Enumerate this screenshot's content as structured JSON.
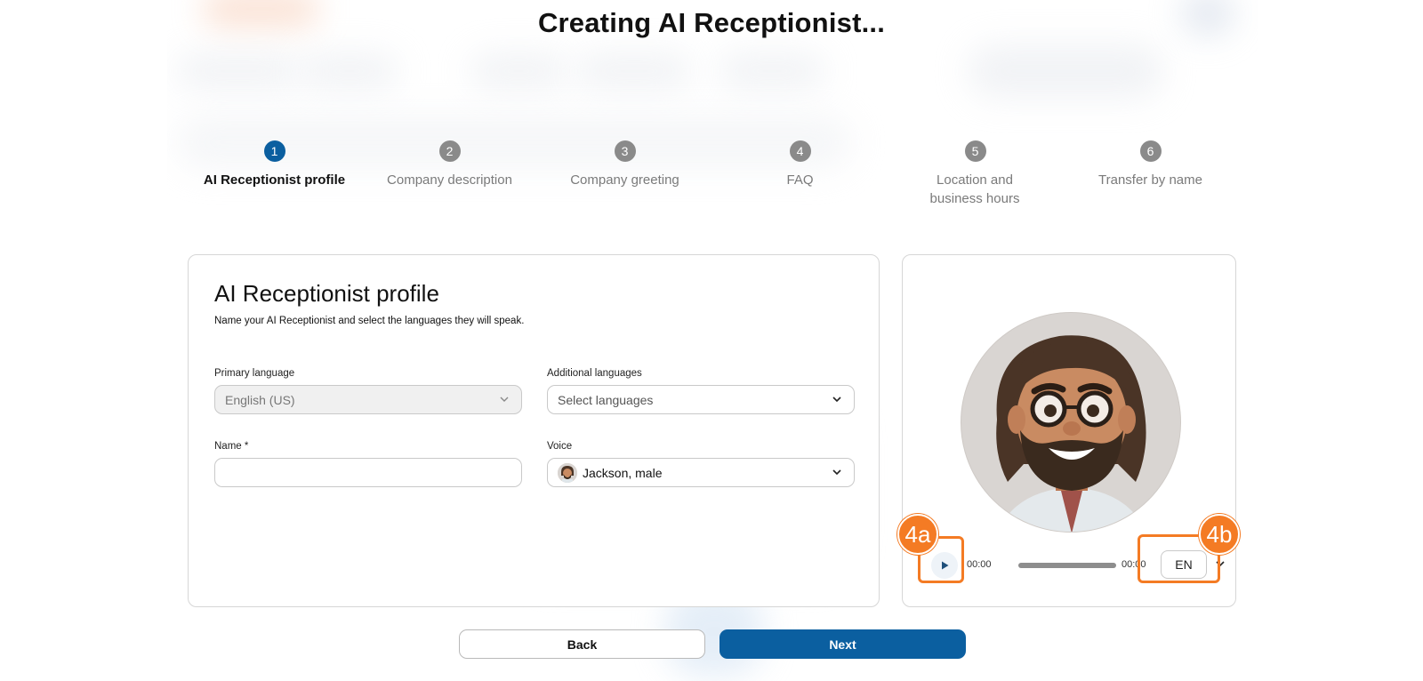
{
  "page": {
    "title": "Creating AI Receptionist..."
  },
  "steps": [
    {
      "number": "1",
      "label": "AI Receptionist profile",
      "active": true
    },
    {
      "number": "2",
      "label": "Company description",
      "active": false
    },
    {
      "number": "3",
      "label": "Company greeting",
      "active": false
    },
    {
      "number": "4",
      "label": "FAQ",
      "active": false
    },
    {
      "number": "5",
      "label": "Location and business hours",
      "active": false
    },
    {
      "number": "6",
      "label": "Transfer by name",
      "active": false
    }
  ],
  "profile": {
    "title": "AI Receptionist profile",
    "subtitle": "Name your AI Receptionist and select the languages they will speak.",
    "primary_language": {
      "label": "Primary language",
      "value": "English (US)"
    },
    "additional_languages": {
      "label": "Additional languages",
      "placeholder": "Select languages"
    },
    "name": {
      "label": "Name *",
      "value": ""
    },
    "voice": {
      "label": "Voice",
      "value": "Jackson, male"
    }
  },
  "player": {
    "current_time": "00:00",
    "duration": "00:00",
    "language": "EN"
  },
  "callouts": {
    "play": "4a",
    "language": "4b"
  },
  "buttons": {
    "back": "Back",
    "next": "Next"
  },
  "colors": {
    "primary": "#0b5fa0",
    "callout": "#f47b24"
  }
}
